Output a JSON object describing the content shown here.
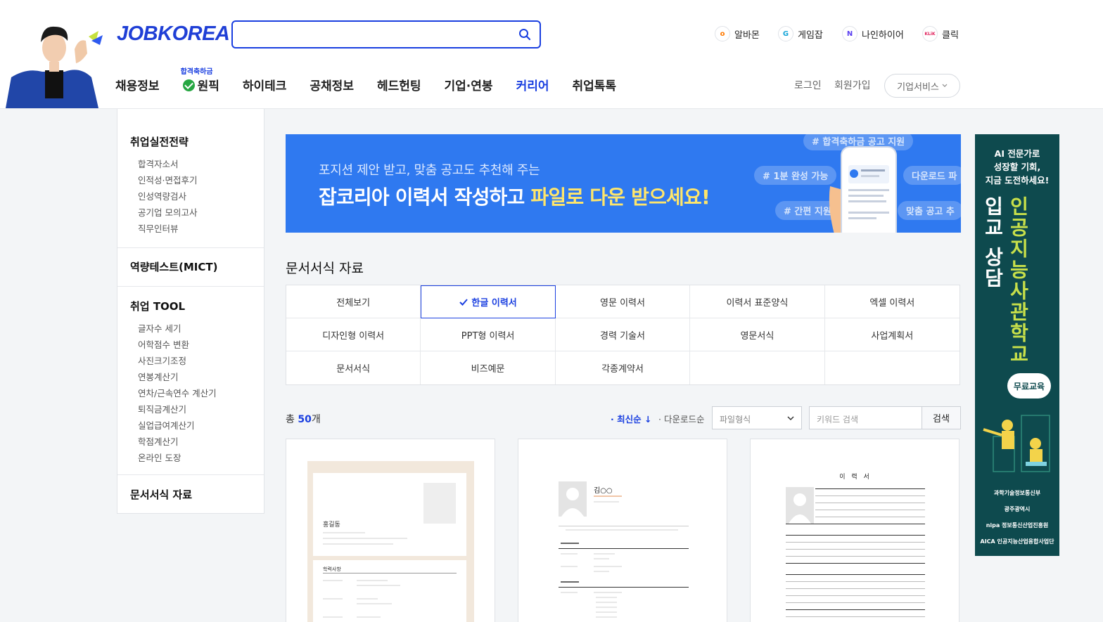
{
  "header": {
    "logo": "JOBKOREA",
    "search_placeholder": "",
    "family_sites": [
      {
        "label": "알바몬",
        "icon": "albamon-icon",
        "color": "#ff7a00",
        "glyph": "o"
      },
      {
        "label": "게임잡",
        "icon": "gamejob-icon",
        "color": "#16a6d8",
        "glyph": "G"
      },
      {
        "label": "나인하이어",
        "icon": "ninehire-icon",
        "color": "#5a3ff0",
        "glyph": "N"
      },
      {
        "label": "클릭",
        "icon": "klik-icon",
        "color": "#e0245e",
        "glyph": "KLiK"
      }
    ],
    "nav": [
      {
        "label": "채용정보"
      },
      {
        "label": "원픽",
        "tag": "합격축하금"
      },
      {
        "label": "하이테크"
      },
      {
        "label": "공채정보"
      },
      {
        "label": "헤드헌팅"
      },
      {
        "label": "기업·연봉"
      },
      {
        "label": "커리어",
        "active": true
      },
      {
        "label": "취업톡톡"
      }
    ],
    "login": "로그인",
    "signup": "회원가입",
    "corp_service": "기업서비스"
  },
  "sidebar": {
    "sections": [
      {
        "title": "취업실전전략",
        "links": [
          "합격자소서",
          "인적성·면접후기",
          "인성역량검사",
          "공기업 모의고사",
          "직무인터뷰"
        ]
      },
      {
        "title": "역량테스트(MICT)",
        "links": []
      },
      {
        "title": "취업 TOOL",
        "links": [
          "글자수 세기",
          "어학점수 변환",
          "사진크기조정",
          "연봉계산기",
          "연차/근속연수 계산기",
          "퇴직금계산기",
          "실업급여계산기",
          "학점계산기",
          "온라인 도장"
        ]
      },
      {
        "title": "문서서식 자료",
        "links": []
      }
    ]
  },
  "banner": {
    "subtitle": "포지션 제안 받고, 맞춤 공고도 추천해 주는",
    "title_prefix": "잡코리아 이력서 작성하고 ",
    "title_highlight": "파일로 다운 받으세요!",
    "hashtags": [
      "# 합격축하금 공고 지원",
      "# 1분 완성 가능",
      "# 간편 지원",
      "다운로드 파",
      "맞춤 공고 추"
    ]
  },
  "section": {
    "title": "문서서식 자료",
    "categories": [
      "전체보기",
      "한글 이력서",
      "영문 이력서",
      "이력서 표준양식",
      "엑셀 이력서",
      "디자인형 이력서",
      "PPT형 이력서",
      "경력 기술서",
      "영문서식",
      "사업계획서",
      "문서서식",
      "비즈예문",
      "각종계약서",
      "",
      ""
    ],
    "selected_category": "한글 이력서"
  },
  "list": {
    "total_prefix": "총 ",
    "total_count": "50",
    "total_suffix": "개",
    "sort_latest": "최신순",
    "sort_download": "다운로드순",
    "file_type_placeholder": "파일형식",
    "keyword_placeholder": "키워드 검색",
    "search_button": "검색"
  },
  "cards": [
    {
      "name": "홍길동"
    },
    {
      "name": "김○○"
    },
    {
      "name": "이 력 서"
    }
  ],
  "ad": {
    "headline_1": "AI 전문가로",
    "headline_2": "성장할 기회,",
    "headline_3": "지금 도전하세요!",
    "vertical_1": "인공지능사관학교",
    "vertical_2": "입교 상담",
    "pill": "무료교육",
    "orgs": [
      "과학기술정보통신부",
      "광주광역시",
      "nipa 정보통신산업진흥원",
      "AICA 인공지능산업융합사업단"
    ],
    "accent": "#c8e04a"
  }
}
